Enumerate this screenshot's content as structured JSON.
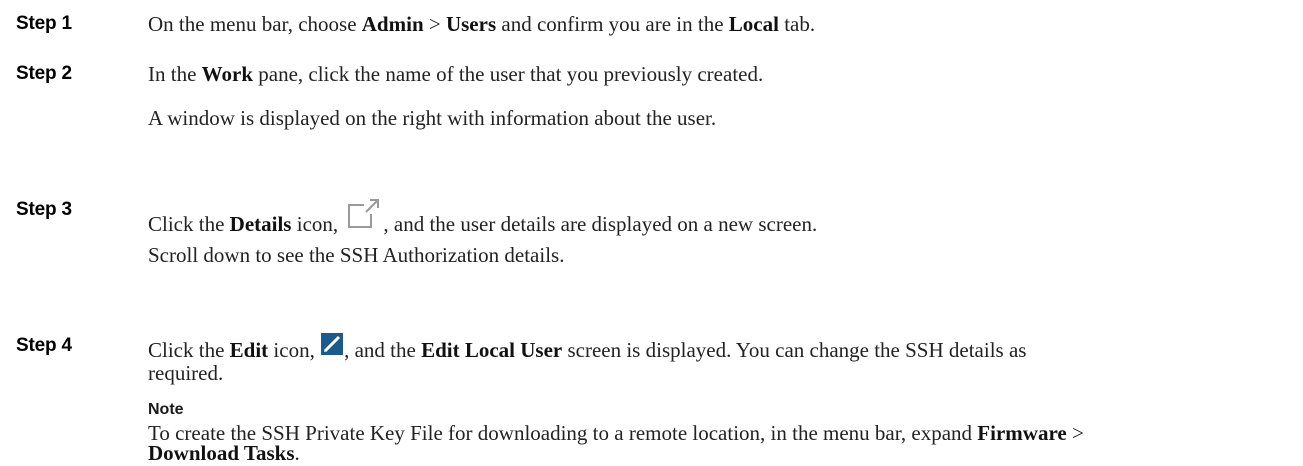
{
  "steps": [
    {
      "label": "Step 1",
      "parts": [
        "On the menu bar, choose ",
        "Admin",
        " > ",
        "Users",
        " and confirm you are in the ",
        "Local",
        " tab."
      ]
    },
    {
      "label": "Step 2",
      "parts": [
        "In the ",
        "Work",
        " pane, click the name of the user that you previously created."
      ],
      "result": "A window is displayed on the right with information about the user."
    },
    {
      "label": "Step 3",
      "parts": [
        "Click the ",
        "Details",
        " icon, ",
        ", and the user details are displayed on a new screen."
      ],
      "result": "Scroll down to see the SSH Authorization details.",
      "icon": "details-external-link-icon"
    },
    {
      "label": "Step 4",
      "parts": [
        "Click the ",
        "Edit",
        " icon, ",
        ", and the ",
        "Edit Local User",
        " screen is displayed. You can change the SSH details as"
      ],
      "continuation": "required.",
      "icon": "edit-pencil-icon",
      "icon_color": "#1c5a8a"
    }
  ],
  "note": {
    "label": "Note",
    "parts": [
      "To create the SSH Private Key File for downloading to a remote location, in the menu bar, expand ",
      "Firmware",
      " >"
    ],
    "line2_bold": "Download Tasks",
    "line2_tail": "."
  }
}
